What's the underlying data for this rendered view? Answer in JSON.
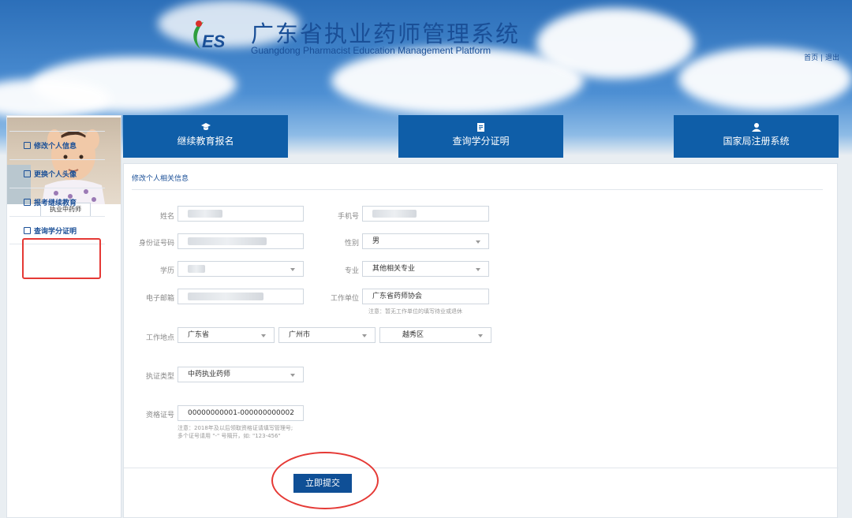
{
  "header": {
    "title": "广东省执业药师管理系统",
    "subtitle": "Guangdong Pharmacist Education Management Platform",
    "logo_text": "ES",
    "links": {
      "home": "首页",
      "sep": "|",
      "logout": "退出"
    }
  },
  "sidebar": {
    "role": "执业中药师",
    "items": [
      {
        "label": "修改个人信息",
        "icon": "edit-icon"
      },
      {
        "label": "更换个人头像",
        "icon": "image-icon"
      },
      {
        "label": "报考继续教育",
        "icon": "print-icon"
      },
      {
        "label": "查询学分证明",
        "icon": "card-icon"
      }
    ]
  },
  "nav": [
    {
      "label": "继续教育报名",
      "icon": "graduation-cap-icon"
    },
    {
      "label": "查询学分证明",
      "icon": "document-icon"
    },
    {
      "label": "国家局注册系统",
      "icon": "user-icon"
    }
  ],
  "form": {
    "section_title": "修改个人相关信息",
    "name_label": "姓名",
    "phone_label": "手机号",
    "id_label": "身份证号码",
    "gender_label": "性别",
    "gender_value": "男",
    "education_label": "学历",
    "major_label": "专业",
    "major_value": "其他相关专业",
    "email_label": "电子邮箱",
    "employer_label": "工作单位",
    "employer_value": "广东省药师协会",
    "employer_note": "注意：暂无工作单位的填写待业或退休",
    "location_label": "工作地点",
    "province": "广东省",
    "city": "广州市",
    "district": "越秀区",
    "cert_type_label": "执证类型",
    "cert_type_value": "中药执业药师",
    "cert_no_label": "资格证号",
    "cert_no_value": "00000000001-000000000002",
    "cert_note": "注意：2018年及以后领取资格证请填写管理号;多个证号请用 \"-\" 号隔开，如: \"123-456\"",
    "submit_label": "立即提交"
  },
  "colors": {
    "brand": "#0f5ea8",
    "highlight": "#e53935"
  }
}
